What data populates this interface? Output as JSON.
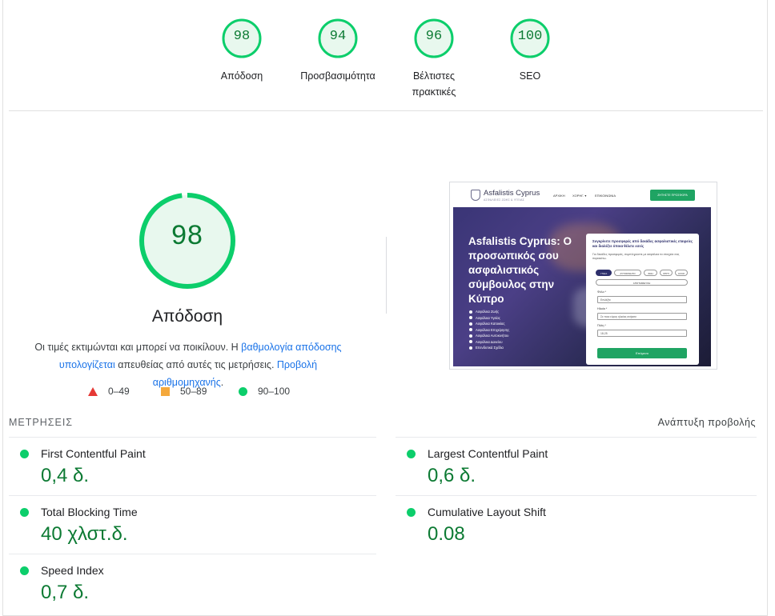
{
  "top_scores": [
    {
      "score": "98",
      "label": "Απόδοση"
    },
    {
      "score": "94",
      "label": "Προσβασιμότητα"
    },
    {
      "score": "96",
      "label": "Βέλτιστες πρακτικές"
    },
    {
      "score": "100",
      "label": "SEO"
    }
  ],
  "main": {
    "score": "98",
    "score_fraction": 0.98,
    "title": "Απόδοση",
    "desc_text1": "Οι τιμές εκτιμώνται και μπορεί να ποικίλουν. Η ",
    "desc_link1": "βαθμολογία απόδοσης υπολογίζεται",
    "desc_text2": " απευθείας από αυτές τις μετρήσεις. ",
    "desc_link2": "Προβολή αριθμομηχανής",
    "desc_text3": "."
  },
  "legend": {
    "fail": "0–49",
    "average": "50–89",
    "pass": "90–100"
  },
  "colors": {
    "pass": "#0cce6b",
    "pass_text": "#0c7a33",
    "average": "#f4a83c",
    "fail": "#e53935",
    "link": "#1a73e8"
  },
  "thumbnail": {
    "brand": "Asfalistis Cyprus",
    "brand_sub": "ΑΣΦΑΛΕΙΕΣ ΖΩΗΣ & ΥΓΕΙΑΣ",
    "nav": [
      "ΑΡΧΙΚΗ",
      "ΧΟΡΗΓ. ▾",
      "ΕΠΙΚΟΙΝΩΝΙΑ"
    ],
    "cta": "ΖΗΤΗΣΤΕ ΠΡΟΣΦΟΡΑ",
    "hero_title": "Asfalistis Cyprus: Ο προσωπικός σου ασφαλιστικός σύμβουλος στην Κύπρο",
    "bullets": [
      "Ασφάλεια Ζωής",
      "Ασφάλεια Υγείας",
      "Ασφάλεια Κατοικίας",
      "Ασφάλεια Επιχείρησης",
      "Ασφάλεια Αυτοκινήτου",
      "Ασφάλεια Δανείου",
      "Επενδυτικά Σχέδια"
    ],
    "form_heading": "Συγκρίνετε προσφορές από δεκάδες ασφαλιστικές εταιρείες και διαλέξτε όποια θέλετε εσείς",
    "form_para": "Για δεκάδες προσφορές, συμπληρώστε με ασφάλεια τα στοιχεία σας παρακάτω.",
    "pills": [
      "ΥΓΕΙΑ",
      "ΑΥΤΟΚΙΝΗΤΟ",
      "ΖΩΗ",
      "ΣΠΙΤΙ",
      "ΑΛΛΟ"
    ],
    "pill_wide": "ΑΠΟΤΑΜΙΕΥΣΗ",
    "fields": [
      {
        "label": "Φύλο *",
        "value": "Επιλέξτε"
      },
      {
        "label": "Ηλικία *",
        "value": "Σε ποιο εύρος ηλικίας ανήκετε"
      },
      {
        "label": "Πόλη *",
        "value": "18-25"
      }
    ],
    "submit": "Επόμενο"
  },
  "metrics": {
    "heading": "ΜΕΤΡΗΣΕΙΣ",
    "expand": "Ανάπτυξη προβολής",
    "items": [
      {
        "name": "First Contentful Paint",
        "value": "0,4 δ."
      },
      {
        "name": "Largest Contentful Paint",
        "value": "0,6 δ."
      },
      {
        "name": "Total Blocking Time",
        "value": "40 χλστ.δ."
      },
      {
        "name": "Cumulative Layout Shift",
        "value": "0.08"
      },
      {
        "name": "Speed Index",
        "value": "0,7 δ."
      }
    ]
  }
}
